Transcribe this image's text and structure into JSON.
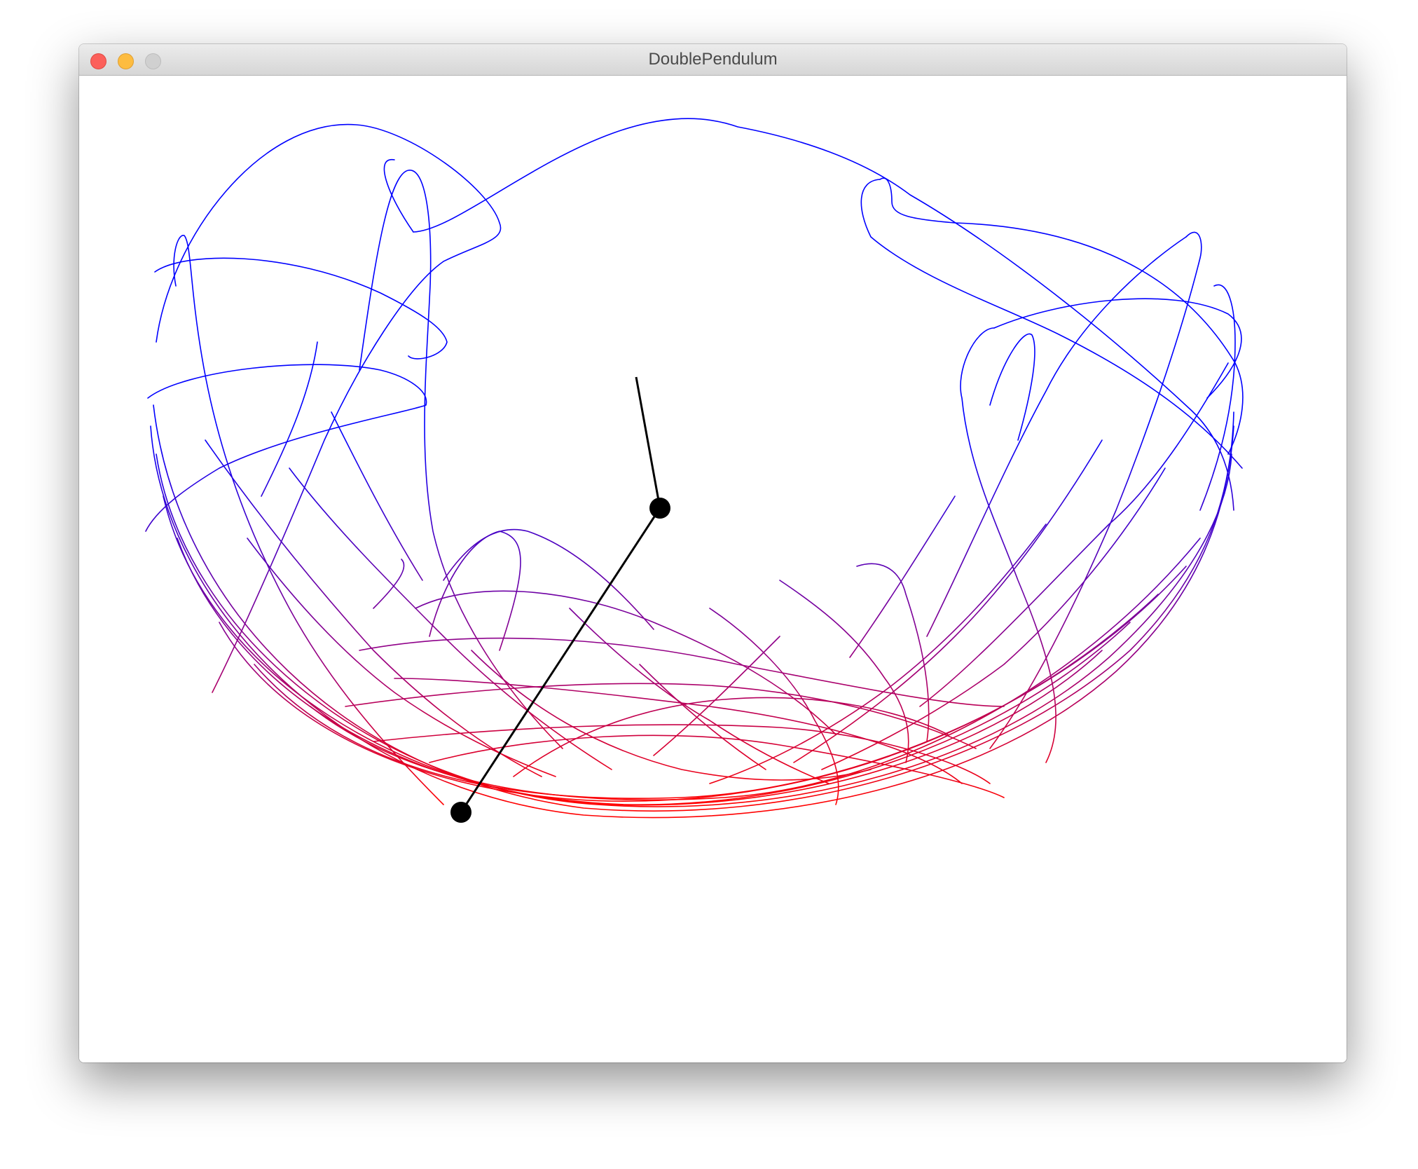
{
  "window": {
    "title": "DoublePendulum"
  },
  "simulation": {
    "trail_color_top": "#0000ff",
    "trail_color_bottom": "#ff0000",
    "arm_color": "#000000",
    "bob_color": "#000000"
  }
}
